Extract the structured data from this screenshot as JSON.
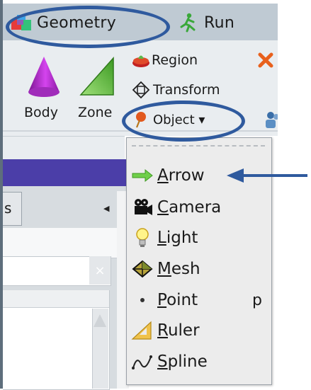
{
  "tabs": {
    "geometry_label": "Geometry",
    "run_label": "Run"
  },
  "ribbon": {
    "body_label": "Body",
    "zone_label": "Zone",
    "region_label": "Region",
    "transform_label": "Transform",
    "object_label": "Object ▾"
  },
  "panel": {
    "tab_text": "s",
    "clear_glyph": "×"
  },
  "menu": {
    "items": [
      {
        "label": "Arrow",
        "icon": "arrow-icon"
      },
      {
        "label": "Camera",
        "icon": "camera-icon"
      },
      {
        "label": "Light",
        "icon": "lightbulb-icon"
      },
      {
        "label": "Mesh",
        "icon": "mesh-icon"
      },
      {
        "label": "Point",
        "icon": "point-icon",
        "shortcut": "p"
      },
      {
        "label": "Ruler",
        "icon": "ruler-icon"
      },
      {
        "label": "Spline",
        "icon": "spline-icon"
      }
    ]
  },
  "colors": {
    "annotation": "#2f5a9e",
    "purple_bar": "#4b3ea8",
    "cone": "#b229c9",
    "zone_green": "#5fb83a",
    "close_x": "#e8601c"
  }
}
